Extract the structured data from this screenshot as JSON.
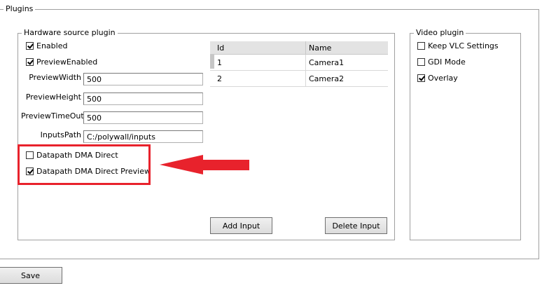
{
  "plugins_group": {
    "title": "Plugins"
  },
  "hardware_group": {
    "title": "Hardware source plugin",
    "enabled": {
      "label": "Enabled",
      "checked": true
    },
    "preview_enabled": {
      "label": "PreviewEnabled",
      "checked": true
    },
    "fields": {
      "preview_width": {
        "label": "PreviewWidth",
        "value": "500"
      },
      "preview_height": {
        "label": "PreviewHeight",
        "value": "500"
      },
      "preview_timeout": {
        "label": "PreviewTimeOut",
        "value": "500"
      },
      "inputs_path": {
        "label": "InputsPath",
        "value": "C:/polywall/inputs"
      }
    },
    "dma_direct": {
      "label": "Datapath DMA Direct",
      "checked": false
    },
    "dma_direct_preview": {
      "label": "Datapath DMA Direct Preview",
      "checked": true
    },
    "table": {
      "columns": [
        "Id",
        "Name"
      ],
      "rows": [
        {
          "id": "1",
          "name": "Camera1"
        },
        {
          "id": "2",
          "name": "Camera2"
        }
      ]
    },
    "add_input_label": "Add Input",
    "delete_input_label": "Delete Input"
  },
  "video_group": {
    "title": "Video plugin",
    "keep_vlc": {
      "label": "Keep VLC Settings",
      "checked": false
    },
    "gdi_mode": {
      "label": "GDI Mode",
      "checked": false
    },
    "overlay": {
      "label": "Overlay",
      "checked": true
    }
  },
  "save_label": "Save",
  "colors": {
    "annotation_red": "#e8222c",
    "group_border": "#a0a0a0",
    "header_bg": "#e3e3e3"
  }
}
